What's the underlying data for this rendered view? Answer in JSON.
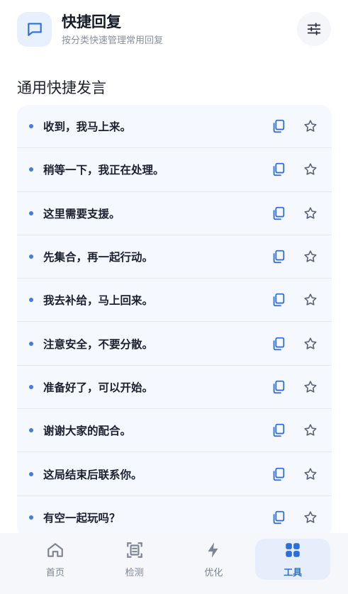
{
  "header": {
    "title": "快捷回复",
    "subtitle": "按分类快速管理常用回复",
    "app_icon": "chat-bubble-icon",
    "settings_icon": "sliders-icon"
  },
  "section": {
    "title": "通用快捷发言"
  },
  "replies": [
    "收到，我马上来。",
    "稍等一下，我正在处理。",
    "这里需要支援。",
    "先集合，再一起行动。",
    "我去补给，马上回来。",
    "注意安全，不要分散。",
    "准备好了，可以开始。",
    "谢谢大家的配合。",
    "这局结束后联系你。",
    "有空一起玩吗？"
  ],
  "nav": [
    {
      "label": "首页",
      "icon": "home-icon",
      "active": false
    },
    {
      "label": "检测",
      "icon": "scan-icon",
      "active": false
    },
    {
      "label": "优化",
      "icon": "bolt-icon",
      "active": false
    },
    {
      "label": "工具",
      "icon": "grid-icon",
      "active": true
    }
  ],
  "colors": {
    "accent": "#3d7ee0",
    "active_nav": "#2c6fd8"
  }
}
